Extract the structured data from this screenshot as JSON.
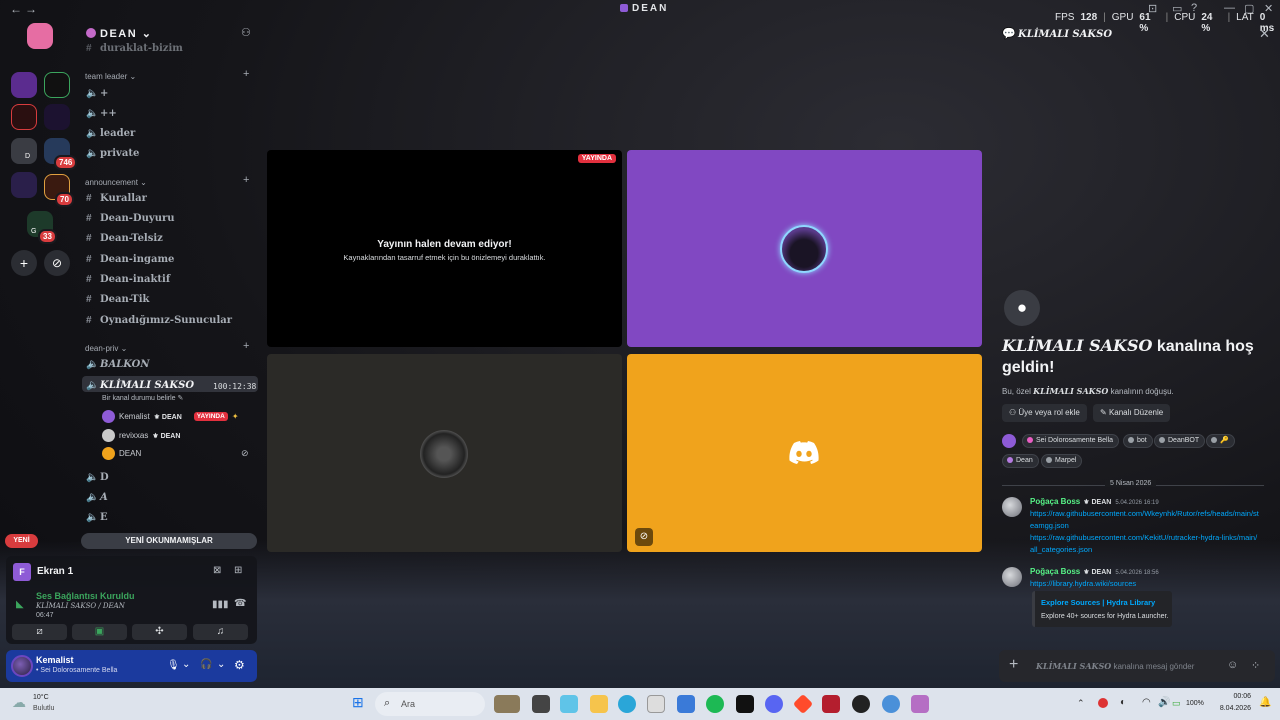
{
  "window": {
    "title": "DEAN",
    "perf": {
      "fps_label": "FPS",
      "fps": "128",
      "gpu_label": "GPU",
      "gpu": "61",
      "cpu_label": "CPU",
      "cpu": "24",
      "lat_label": "LAT",
      "lat": "0 ms"
    }
  },
  "rail": {
    "badges": [
      "746",
      "70",
      "33"
    ],
    "server_letters": [
      "D",
      "G"
    ]
  },
  "channels": {
    "guild_name": "DEAN",
    "top_clipped": "duraklat-bizim",
    "categories": [
      {
        "name": "team leader",
        "items": [
          "+",
          "++",
          "leader",
          "private"
        ]
      },
      {
        "name": "announcement",
        "items": [
          "Kurallar",
          "Dean-Duyuru",
          "Dean-Telsiz",
          "Dean-ingame",
          "Dean-inaktif",
          "Dean-Tik",
          "Oynadığımız-Sunucular"
        ]
      },
      {
        "name": "dean-priv",
        "items": [
          "BALKON",
          "KLİMALI SAKSO",
          "D",
          "A",
          "E"
        ]
      }
    ],
    "active_timer": "100:12:38",
    "active_status": "Bir kanal durumu belirle",
    "voice_users": [
      {
        "name": "Kemalist",
        "tag": "DEAN",
        "live": "YAYINDA"
      },
      {
        "name": "revixxas",
        "tag": "DEAN"
      },
      {
        "name": "DEAN"
      }
    ],
    "unread_button": "YENİ OKUNMAMIŞLAR",
    "new_pill": "YENİ"
  },
  "screen_panel": {
    "title": "Ekran 1",
    "connection": "Ses Bağlantısı Kuruldu",
    "channel_path": "KLİMALI SAKSO / DEAN",
    "elapsed": "06:47"
  },
  "user_panel": {
    "name": "Kemalist",
    "status": "Sei Dolorosamente Bella"
  },
  "stream": {
    "live_tag": "YAYINDA",
    "paused_title": "Yayının halen devam ediyor!",
    "paused_sub": "Kaynaklarından tasarruf etmek için bu önizlemeyi duraklattık."
  },
  "colors": {
    "purple_tile": "#8148c2",
    "grey_tile": "#2b2a27",
    "orange_tile": "#f0a31c",
    "accent_blue": "#1b3a9e"
  },
  "chat": {
    "header_name": "KLİMALI SAKSO",
    "welcome_name": "KLİMALI SAKSO",
    "welcome_suffix": " kanalına hoş geldin!",
    "welcome_sub_prefix": "Bu, özel ",
    "welcome_sub_name": "KLİMALI SAKSO",
    "welcome_sub_suffix": " kanalının doğuşu.",
    "btn_add_member": "Üye veya rol ekle",
    "btn_edit_channel": "Kanalı Düzenle",
    "roles": [
      {
        "name": "Sei Dolorosamente Bella",
        "color": "#e95ec4"
      },
      {
        "name": "bot",
        "color": "#9aa0a6"
      },
      {
        "name": "DeanBOT",
        "color": "#9aa0a6"
      },
      {
        "name": "🔑",
        "color": "#9aa0a6"
      },
      {
        "name": "Dean",
        "color": "#b57be0"
      },
      {
        "name": "Marpel",
        "color": "#9aa0a6"
      }
    ],
    "date_divider": "5 Nisan 2026",
    "messages": [
      {
        "author": "Poğaça Boss",
        "tag": "DEAN",
        "time": "5.04.2026 16:19",
        "lines": [
          "https://raw.githubusercontent.com/Wkeynhk/Rutor/refs/heads/main/steamgg.json",
          "https://raw.githubusercontent.com/KekitU/rutracker-hydra-links/main/all_categories.json"
        ]
      },
      {
        "author": "Poğaça Boss",
        "tag": "DEAN",
        "time": "5.04.2026 18:56",
        "lines": [
          "https://library.hydra.wiki/sources"
        ],
        "embed_title": "Explore Sources | Hydra Library",
        "embed_desc": "Explore 40+ sources for Hydra Launcher."
      }
    ],
    "composer_name": "KLİMALI SAKSO",
    "composer_suffix": " kanalına mesaj gönder"
  },
  "taskbar": {
    "weather_temp": "10°C",
    "weather_desc": "Bulutlu",
    "search_placeholder": "Ara",
    "battery": "100%",
    "time": "00:06",
    "date": "8.04.2026"
  }
}
